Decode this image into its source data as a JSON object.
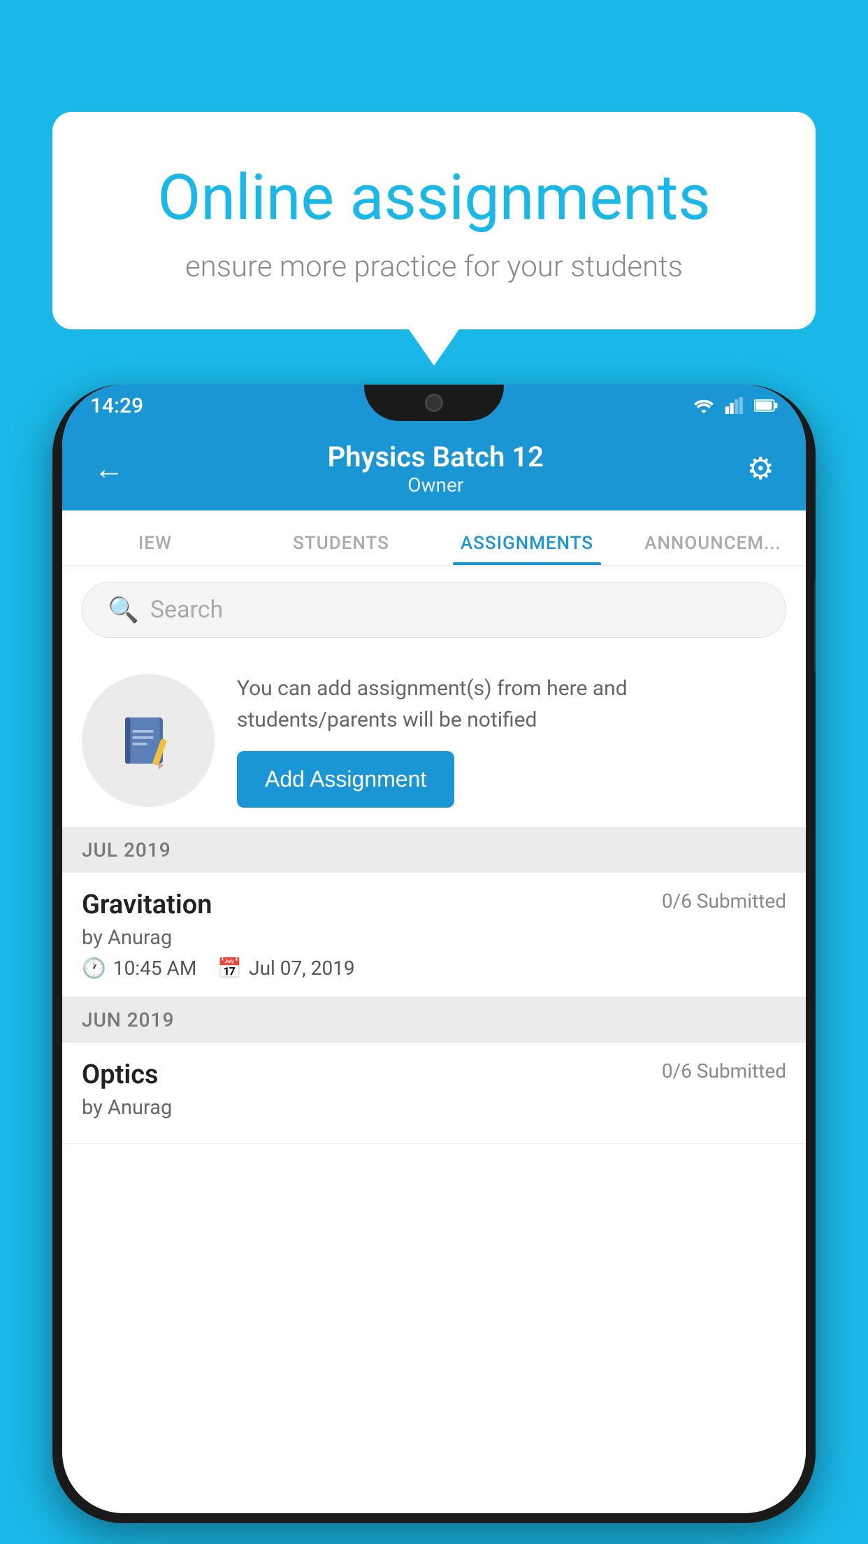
{
  "background_color": "#1ab8e8",
  "speech_bubble": {
    "title": "Online assignments",
    "subtitle": "ensure more practice for your students"
  },
  "status_bar": {
    "time": "14:29"
  },
  "app_bar": {
    "title": "Physics Batch 12",
    "subtitle": "Owner",
    "back_label": "←",
    "settings_label": "⚙"
  },
  "tabs": [
    {
      "label": "IEW",
      "active": false
    },
    {
      "label": "STUDENTS",
      "active": false
    },
    {
      "label": "ASSIGNMENTS",
      "active": true
    },
    {
      "label": "ANNOUNCEM...",
      "active": false
    }
  ],
  "search": {
    "placeholder": "Search"
  },
  "info_card": {
    "description": "You can add assignment(s) from here and students/parents will be notified",
    "button_label": "Add Assignment"
  },
  "sections": [
    {
      "label": "JUL 2019",
      "assignments": [
        {
          "title": "Gravitation",
          "submitted": "0/6 Submitted",
          "author": "by Anurag",
          "time": "10:45 AM",
          "date": "Jul 07, 2019"
        }
      ]
    },
    {
      "label": "JUN 2019",
      "assignments": [
        {
          "title": "Optics",
          "submitted": "0/6 Submitted",
          "author": "by Anurag",
          "time": "",
          "date": ""
        }
      ]
    }
  ]
}
